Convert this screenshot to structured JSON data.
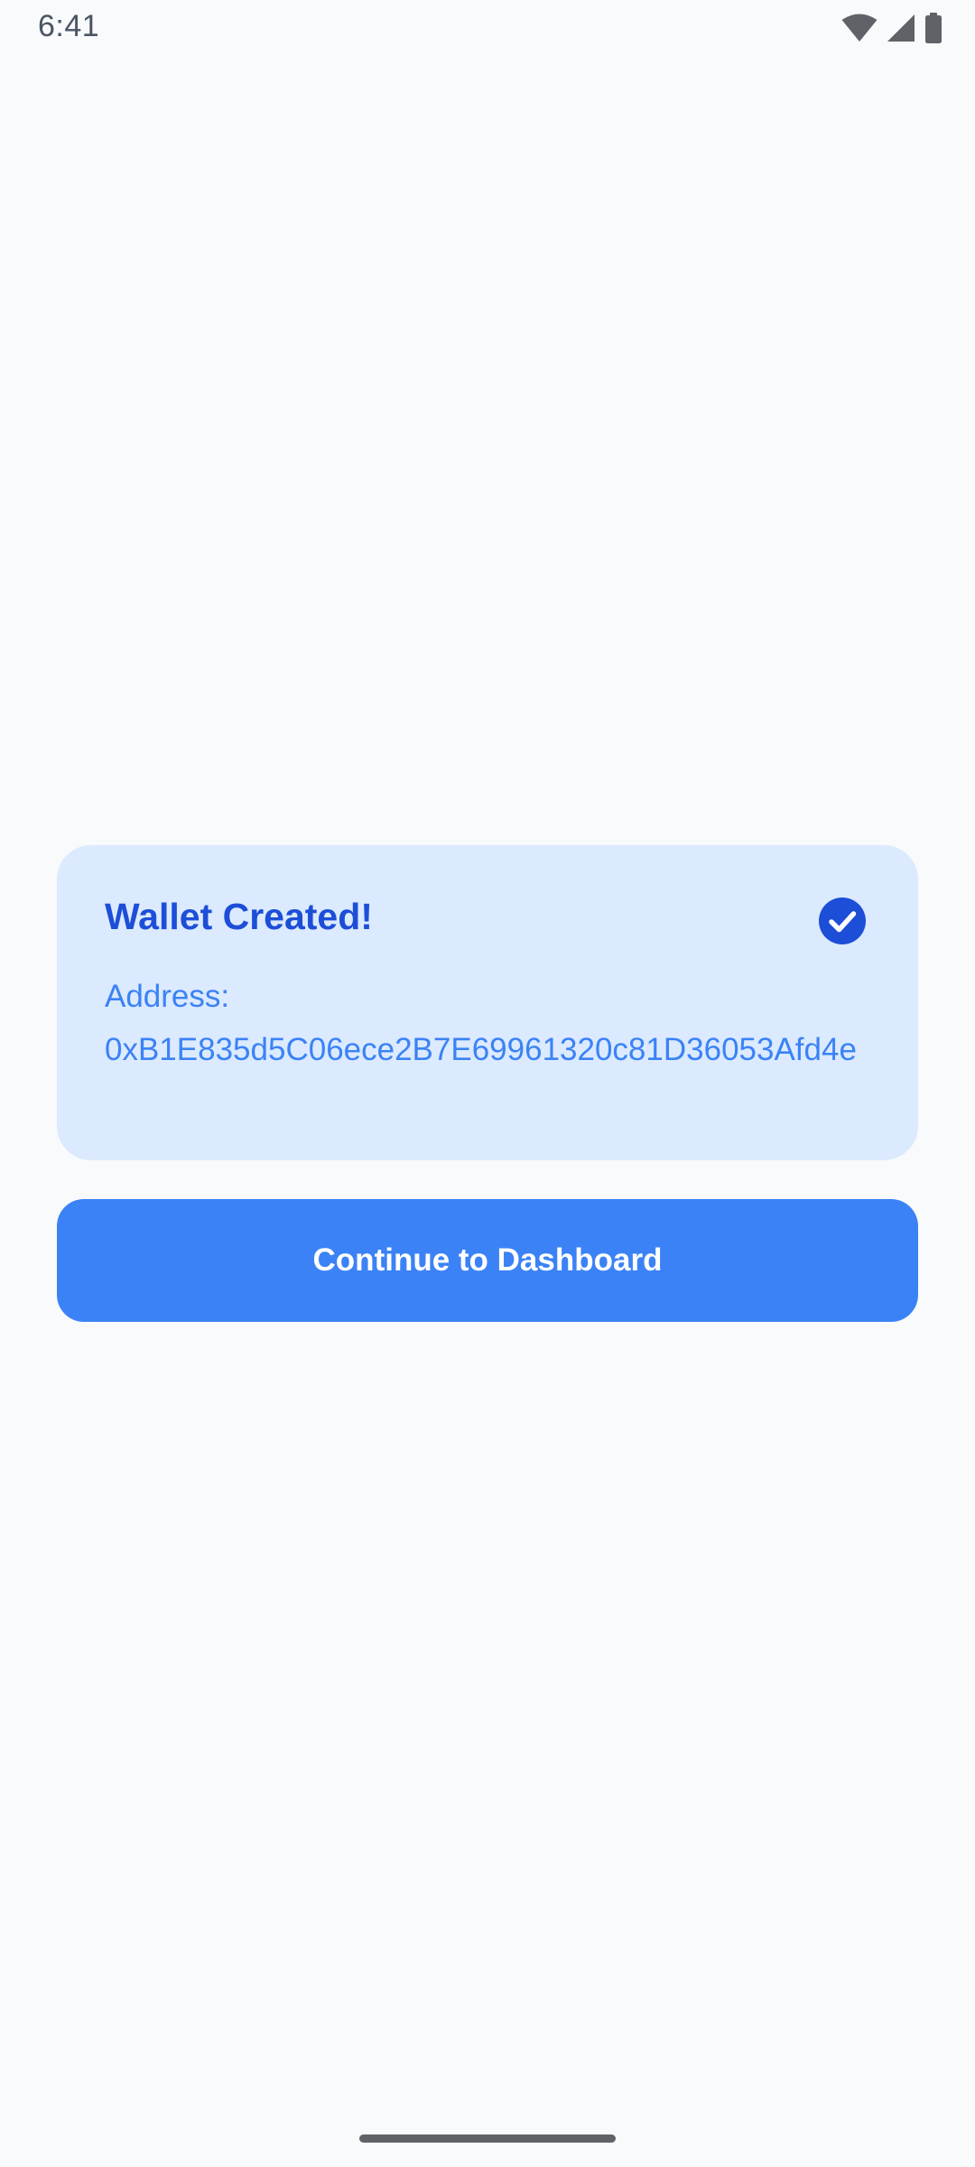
{
  "status_bar": {
    "time": "6:41",
    "icons": [
      "wifi-icon",
      "cell-signal-icon",
      "battery-icon"
    ]
  },
  "card": {
    "title": "Wallet Created!",
    "status_icon": "check-circle-icon",
    "address_label": "Address:",
    "address_value": "0xB1E835d5C06ece2B7E69961320c81D36053Afd4e"
  },
  "actions": {
    "continue_label": "Continue to Dashboard"
  },
  "colors": {
    "background": "#F8FAFC",
    "card_background": "#DBEAFE",
    "title_text": "#1D4ED8",
    "body_text": "#3B82F6",
    "primary_button": "#3B82F6",
    "check_fill": "#1D4ED8"
  }
}
